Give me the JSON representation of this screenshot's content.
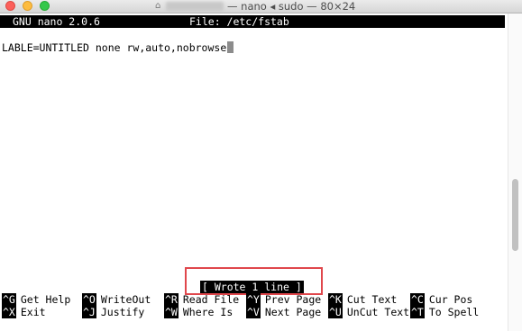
{
  "window": {
    "title": "— nano ◂ sudo — 80×24",
    "home_icon": "⌂"
  },
  "nano": {
    "version": "GNU nano 2.0.6",
    "file": "File: /etc/fstab",
    "content": "LABLE=UNTITLED none rw,auto,nobrowse",
    "status_message": "[ Wrote 1 line ]"
  },
  "shortcuts": {
    "row1": [
      {
        "key": "^G",
        "label": "Get Help"
      },
      {
        "key": "^O",
        "label": "WriteOut"
      },
      {
        "key": "^R",
        "label": "Read File"
      },
      {
        "key": "^Y",
        "label": "Prev Page"
      },
      {
        "key": "^K",
        "label": "Cut Text"
      },
      {
        "key": "^C",
        "label": "Cur Pos"
      }
    ],
    "row2": [
      {
        "key": "^X",
        "label": "Exit"
      },
      {
        "key": "^J",
        "label": "Justify"
      },
      {
        "key": "^W",
        "label": "Where Is"
      },
      {
        "key": "^V",
        "label": "Next Page"
      },
      {
        "key": "^U",
        "label": "UnCut Text"
      },
      {
        "key": "^T",
        "label": "To Spell"
      }
    ]
  }
}
